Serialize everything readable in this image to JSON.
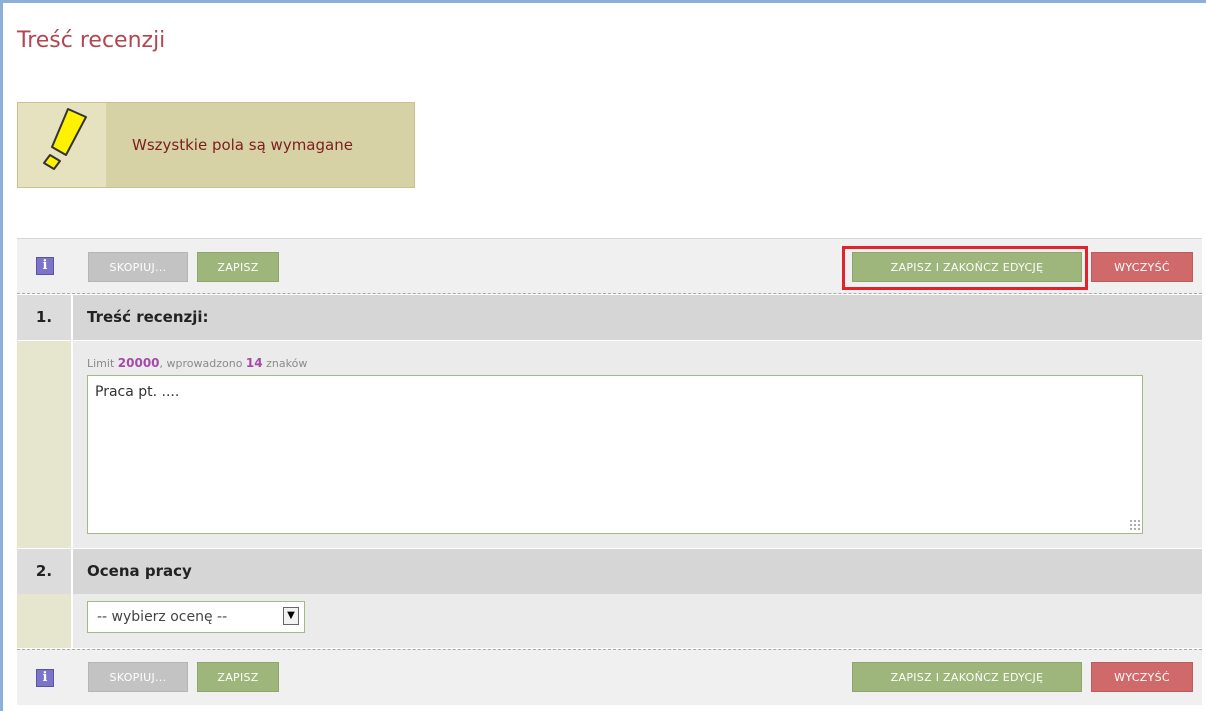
{
  "page": {
    "title": "Treść recenzji"
  },
  "warning": {
    "icon": "exclamation-icon",
    "text": "Wszystkie pola są wymagane"
  },
  "toolbar": {
    "info_icon": "i",
    "copy_label": "SKOPIUJ...",
    "save_label": "ZAPISZ",
    "save_finish_label": "ZAPISZ I ZAKOŃCZ EDYCJĘ",
    "clear_label": "WYCZYŚĆ"
  },
  "fields": [
    {
      "num": "1.",
      "label": "Treść recenzji:",
      "limit_prefix": "Limit ",
      "limit_value": "20000",
      "limit_mid": ", wprowadzono ",
      "entered_value": "14",
      "limit_suffix": " znaków",
      "value": "Praca pt. ...."
    },
    {
      "num": "2.",
      "label": "Ocena pracy",
      "select_value": "-- wybierz ocenę --"
    }
  ],
  "colors": {
    "title": "#b2474f",
    "green_button": "#9eb57b",
    "red_button": "#d06a6a",
    "gray_button": "#c3c3c3",
    "highlight": "#e3232b"
  }
}
